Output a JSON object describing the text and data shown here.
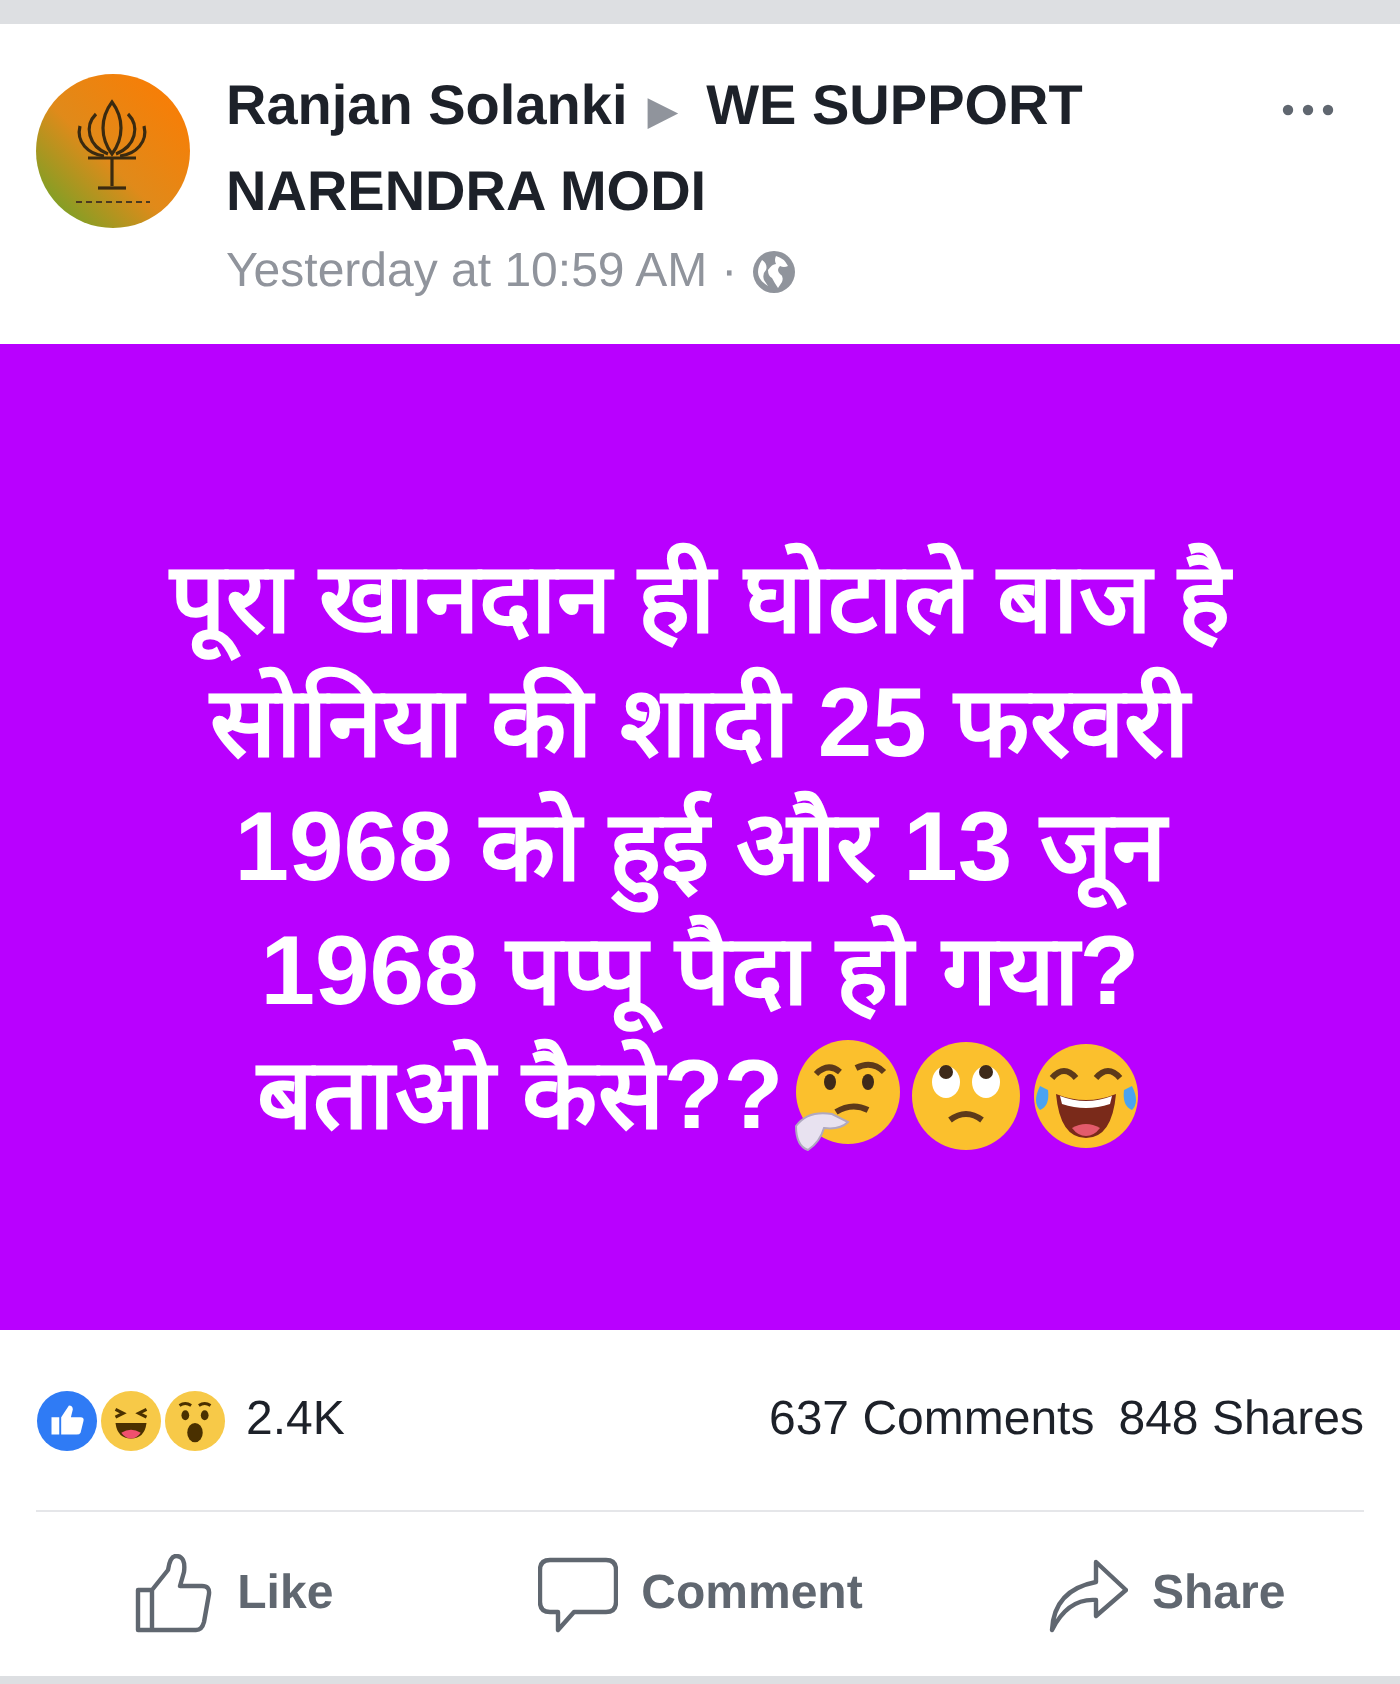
{
  "post": {
    "author": "Ranjan Solanki",
    "arrow": "▶",
    "group": "WE SUPPORT NARENDRA MODI",
    "time": "Yesterday at 10:59 AM",
    "separator": "·"
  },
  "image": {
    "lines": [
      "पूरा खानदान ही घोटाले बाज है",
      "सोनिया की शादी 25 फरवरी",
      "1968 को हुई और 13 जून",
      "1968 पप्पू पैदा हो गया?",
      "बताओ कैसे??"
    ],
    "emojis": [
      {
        "kind": "thinking"
      },
      {
        "kind": "eye_roll"
      },
      {
        "kind": "laughing"
      }
    ]
  },
  "stats": {
    "reactions": [
      {
        "kind": "like"
      },
      {
        "kind": "haha"
      },
      {
        "kind": "wow"
      }
    ],
    "count": "2.4K",
    "comments": "637 Comments",
    "shares": "848 Shares"
  },
  "actions": [
    {
      "kind": "like",
      "label": "Like"
    },
    {
      "kind": "comment",
      "label": "Comment"
    },
    {
      "kind": "share",
      "label": "Share"
    }
  ]
}
